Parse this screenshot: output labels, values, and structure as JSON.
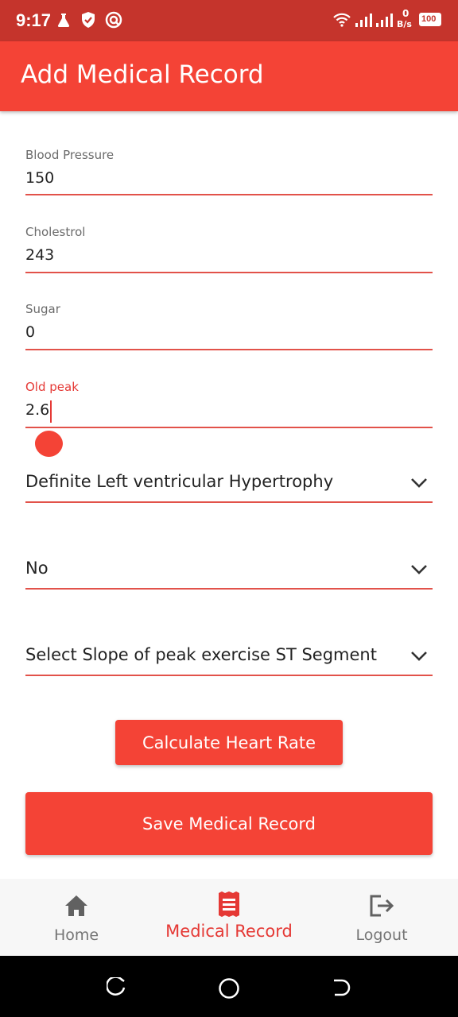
{
  "status_bar": {
    "time": "9:17",
    "net_speed_value": "0",
    "net_speed_unit": "B/s",
    "battery": "100"
  },
  "app_bar": {
    "title": "Add Medical Record"
  },
  "form": {
    "blood_pressure": {
      "label": "Blood Pressure",
      "value": "150"
    },
    "cholesterol": {
      "label": "Cholestrol",
      "value": "243"
    },
    "sugar": {
      "label": "Sugar",
      "value": "0"
    },
    "old_peak": {
      "label": "Old peak",
      "value": "2.6"
    },
    "resting_ecg": {
      "selected": "Definite Left ventricular Hypertrophy"
    },
    "exercise_angina": {
      "selected": "No"
    },
    "slope": {
      "selected": "Select Slope of peak exercise ST Segment"
    }
  },
  "buttons": {
    "calculate": "Calculate Heart Rate",
    "save": "Save Medical Record"
  },
  "bottom_nav": {
    "items": [
      {
        "label": "Home",
        "icon": "home-icon"
      },
      {
        "label": "Medical Record",
        "icon": "medical-record-icon"
      },
      {
        "label": "Logout",
        "icon": "logout-icon"
      }
    ],
    "active_index": 1
  },
  "colors": {
    "primary": "#f44336",
    "status_bar": "#c5342c",
    "underline": "#e2524a",
    "active_label": "#e53935"
  }
}
